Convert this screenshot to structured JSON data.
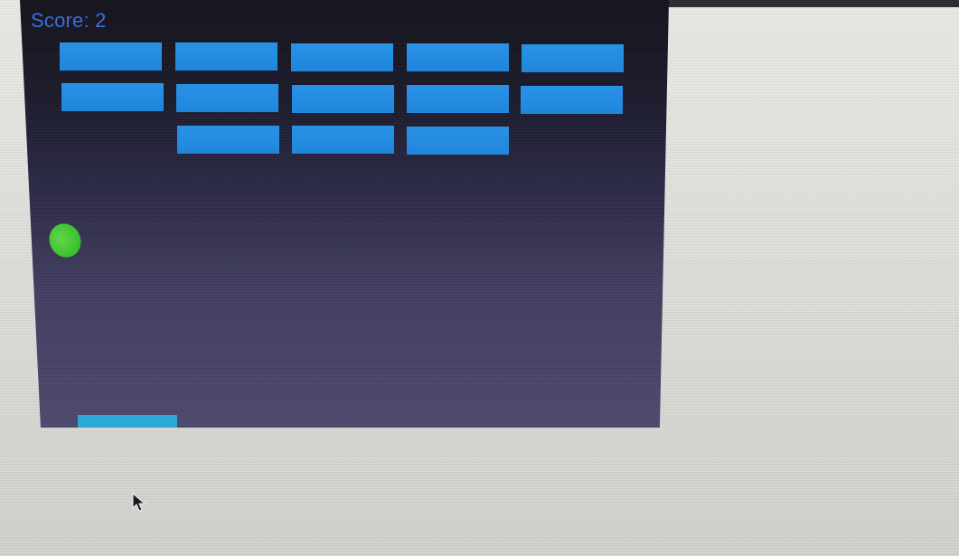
{
  "game": {
    "score_text": "Score: 2"
  },
  "bricks": {
    "rows": [
      [
        "brick",
        "brick",
        "brick",
        "brick",
        "brick"
      ],
      [
        "brick",
        "brick",
        "brick",
        "brick",
        "brick"
      ],
      [
        "",
        "brick",
        "brick",
        "brick",
        ""
      ]
    ]
  },
  "colors": {
    "canvas_top": "#15141d",
    "canvas_bottom": "#4f4a70",
    "brick": "#2a92e6",
    "ball": "#3cbf2c",
    "paddle": "#2aa9d6",
    "score_text": "#3a6de0",
    "background": "#dcdcd8"
  },
  "icons": {
    "cursor": "mouse-pointer-icon"
  }
}
